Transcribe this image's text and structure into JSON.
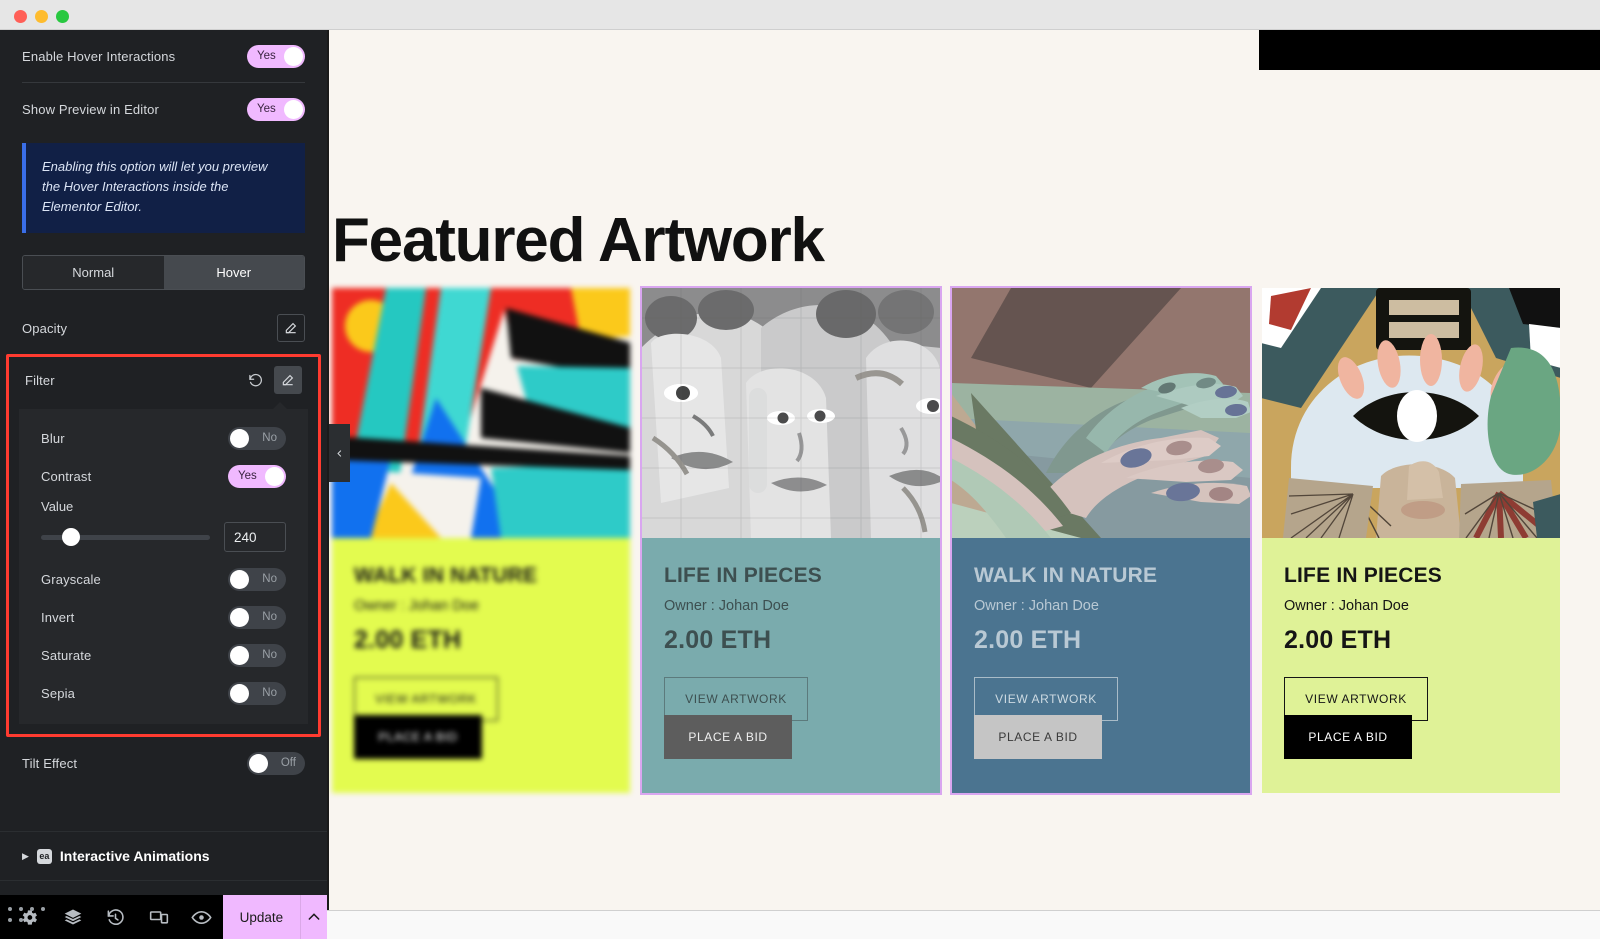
{
  "window": {
    "traffic_lights": [
      "close",
      "minimize",
      "maximize"
    ]
  },
  "panel": {
    "settings": [
      {
        "label": "Enable Hover Interactions",
        "value": "Yes",
        "state": "on"
      },
      {
        "label": "Show Preview in Editor",
        "value": "Yes",
        "state": "on"
      }
    ],
    "notice": "Enabling this option will let you preview the Hover Interactions inside the Elementor Editor.",
    "tabs": [
      {
        "label": "Normal",
        "active": false
      },
      {
        "label": "Hover",
        "active": true
      }
    ],
    "opacity": {
      "label": "Opacity",
      "edit_icon": "pencil-icon"
    },
    "filter": {
      "label": "Filter",
      "reset_icon": "reset-icon",
      "edit_icon": "pencil-icon",
      "items": [
        {
          "label": "Blur",
          "value": "No",
          "state": "off"
        },
        {
          "label": "Contrast",
          "value": "Yes",
          "state": "on"
        }
      ],
      "value_label": "Value",
      "value_number": "240",
      "slider_percent": 18,
      "items_after": [
        {
          "label": "Grayscale",
          "value": "No",
          "state": "off"
        },
        {
          "label": "Invert",
          "value": "No",
          "state": "off"
        },
        {
          "label": "Saturate",
          "value": "No",
          "state": "off"
        },
        {
          "label": "Sepia",
          "value": "No",
          "state": "off"
        }
      ]
    },
    "tilt": {
      "label": "Tilt Effect",
      "value": "Off",
      "state": "off"
    },
    "section": {
      "caret": "caret-right-icon",
      "badge": "ea",
      "title": "Interactive Animations"
    },
    "footer": {
      "icons": [
        "gear-icon",
        "layers-icon",
        "history-icon",
        "responsive-icon",
        "eye-icon"
      ],
      "update_label": "Update",
      "caret": "chevron-up-icon"
    }
  },
  "preview": {
    "page_title": "Featured Artwork",
    "collapse_handle": "chevron-left-icon",
    "cards": [
      {
        "title": "WALK IN NATURE",
        "owner": "Owner : Johan Doe",
        "price": "2.00 ETH",
        "view_label": "VIEW ARTWORK",
        "bid_label": "PLACE A BID",
        "theme": "t-lime",
        "artwork": "abstract-geometric-sun",
        "blurred": true,
        "outlined": false
      },
      {
        "title": "LIFE IN PIECES",
        "owner": "Owner : Johan Doe",
        "price": "2.00 ETH",
        "view_label": "VIEW ARTWORK",
        "bid_label": "PLACE A BID",
        "theme": "t-teal",
        "artwork": "mural-faces-grayscale",
        "blurred": false,
        "outlined": true
      },
      {
        "title": "WALK IN NATURE",
        "owner": "Owner : Johan Doe",
        "price": "2.00 ETH",
        "view_label": "VIEW ARTWORK",
        "bid_label": "PLACE A BID",
        "theme": "t-slate",
        "artwork": "open-hands-illustration",
        "blurred": false,
        "outlined": true
      },
      {
        "title": "LIFE IN PIECES",
        "owner": "Owner : Johan Doe",
        "price": "2.00 ETH",
        "view_label": "VIEW ARTWORK",
        "bid_label": "PLACE A BID",
        "theme": "t-lime2",
        "artwork": "collage-eye-face",
        "blurred": false,
        "outlined": false
      }
    ]
  },
  "colors": {
    "accent_pink": "#f0b9ff",
    "highlight_red": "#ff3b30",
    "notice_blue": "#3a6ee8",
    "panel_bg": "#1f2124",
    "preview_bg": "#f9f5f0",
    "lime": "#e3fb4f",
    "lime_soft": "#dff297",
    "teal": "#7aabad",
    "slate": "#4b7490"
  }
}
